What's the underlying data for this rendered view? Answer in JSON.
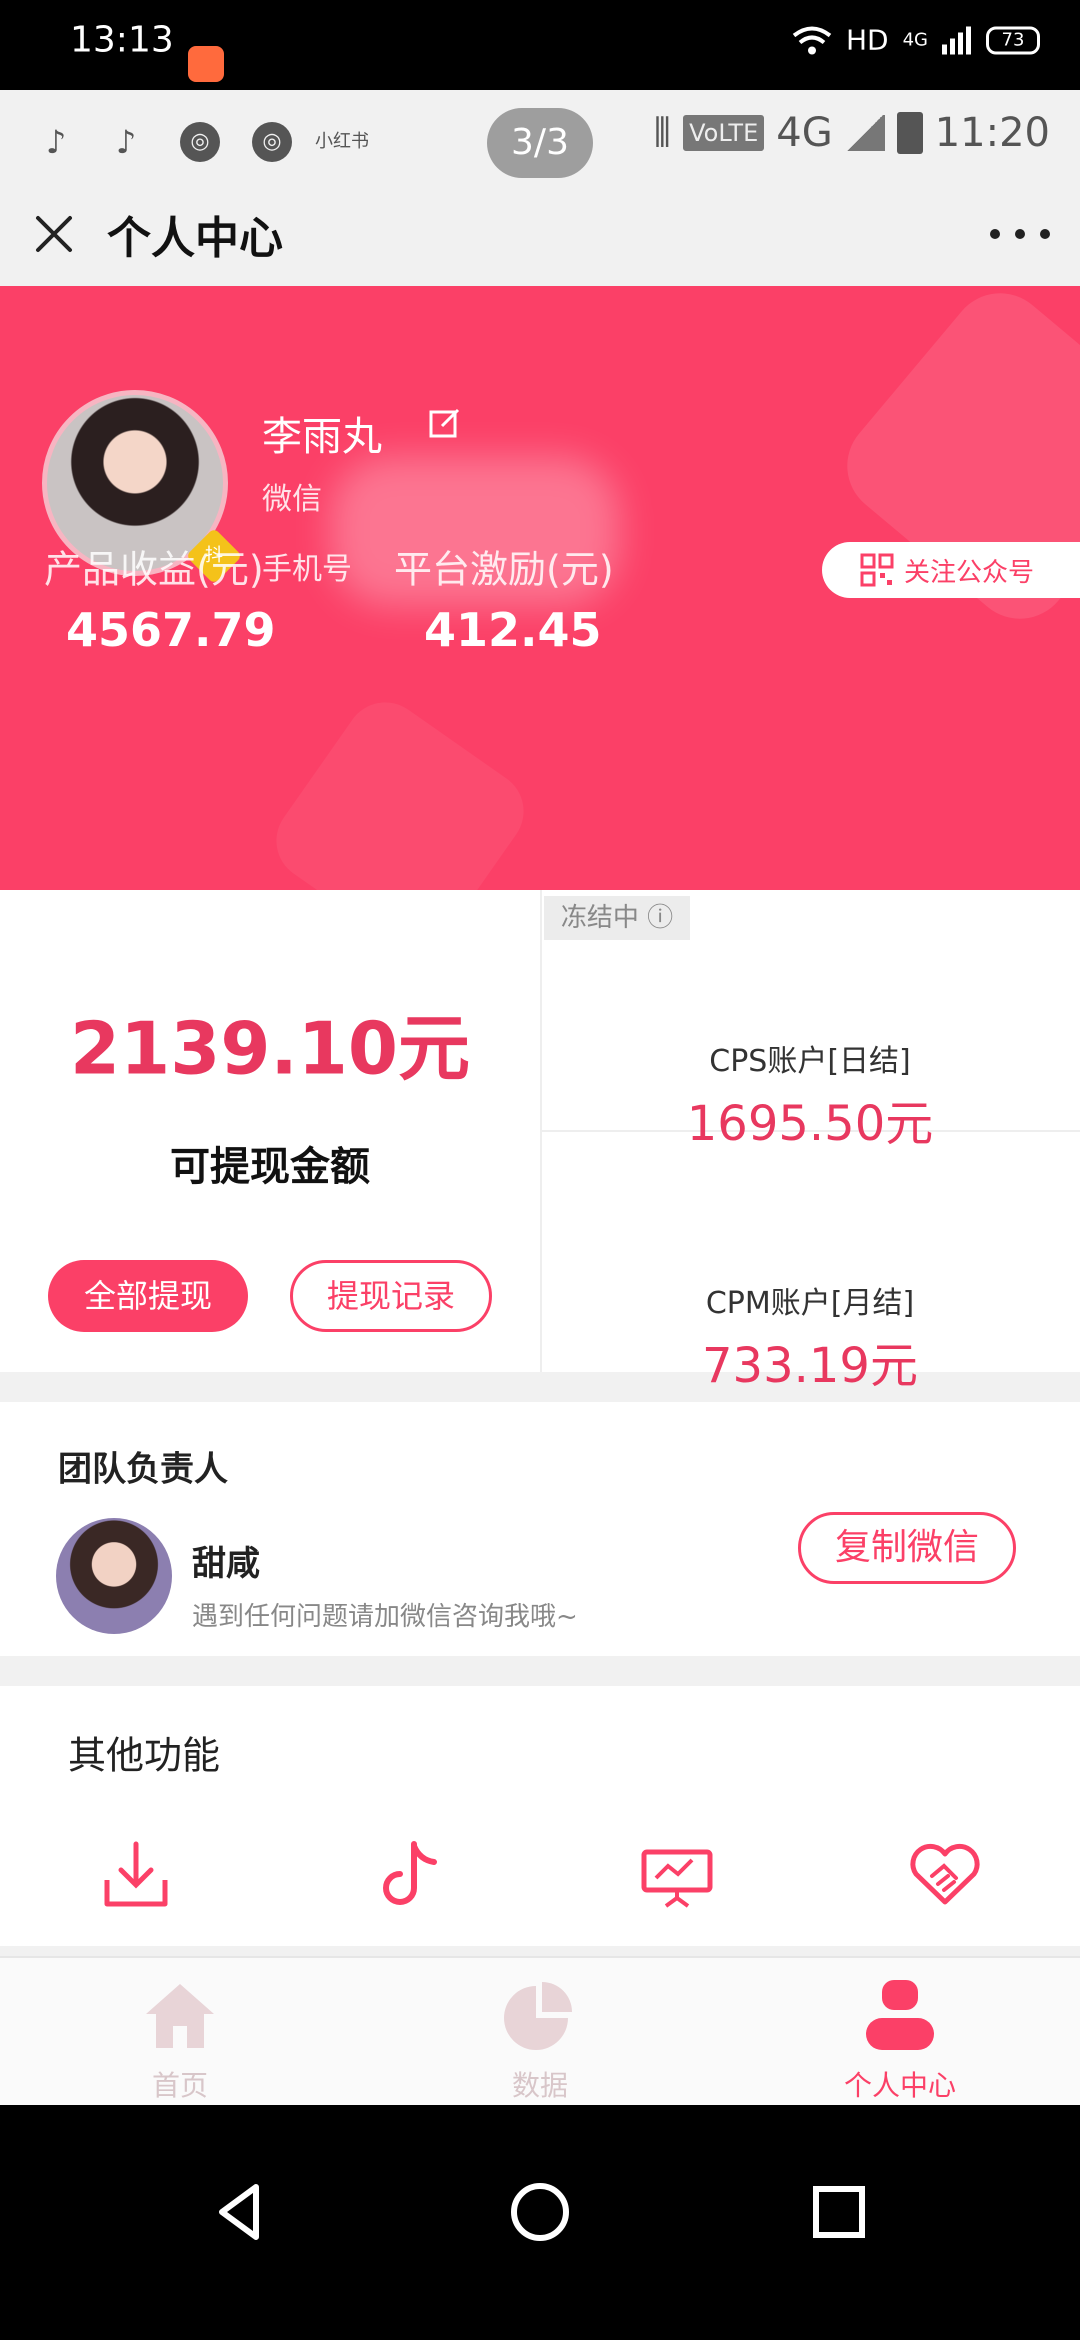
{
  "outer_status": {
    "time": "13:13",
    "network": "HD",
    "net_gen": "4G",
    "battery": "73"
  },
  "inner_status": {
    "pager": "3/3",
    "left_icons": [
      "tiktok-icon",
      "tiktok-icon",
      "aperture-icon",
      "aperture-icon",
      "xiaohongshu-icon"
    ],
    "xhs_label": "小红书",
    "volte": "VoLTE",
    "net": "4G",
    "time": "11:20"
  },
  "titlebar": {
    "title": "个人中心"
  },
  "profile": {
    "name": "李雨丸",
    "wechat_label": "微信",
    "phone_label": "手机号",
    "badge": "抖",
    "follow_label": "关注公众号"
  },
  "earnings": {
    "product_label": "产品收益(元)",
    "product_value": "4567.79",
    "platform_label": "平台激励(元)",
    "platform_value": "412.45"
  },
  "withdraw": {
    "amount": "2139.10元",
    "label": "可提现金额",
    "btn_all": "全部提现",
    "btn_record": "提现记录"
  },
  "accounts": {
    "frozen": "冻结中",
    "cps_label": "CPS账户[日结]",
    "cps_value": "1695.50元",
    "cpm_label": "CPM账户[月结]",
    "cpm_value": "733.19元"
  },
  "team": {
    "heading": "团队负责人",
    "name": "甜咸",
    "tip": "遇到任何问题请加微信咨询我哦~",
    "copy_btn": "复制微信"
  },
  "other": {
    "heading": "其他功能",
    "icons": [
      "download-icon",
      "tiktok-icon",
      "presentation-icon",
      "handshake-icon"
    ]
  },
  "bottom_nav": [
    {
      "label": "首页",
      "icon": "home-icon"
    },
    {
      "label": "数据",
      "icon": "pie-chart-icon"
    },
    {
      "label": "个人中心",
      "icon": "user-icon"
    }
  ],
  "colors": {
    "brand": "#fb4067",
    "accent_text": "#e8385f"
  }
}
